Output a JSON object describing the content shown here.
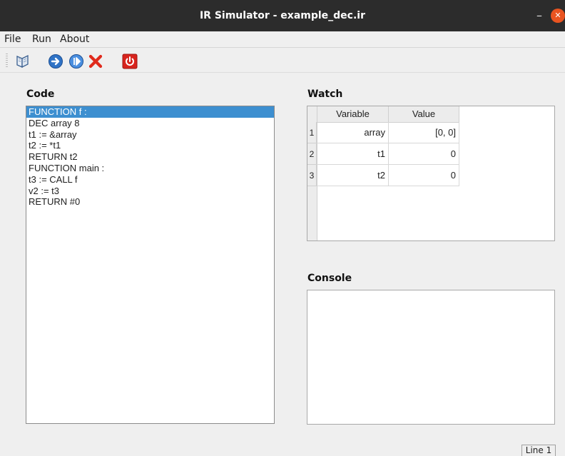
{
  "window": {
    "title": "IR Simulator - example_dec.ir",
    "close_glyph": "✕",
    "minimize_glyph": "–"
  },
  "menu": {
    "items": [
      "File",
      "Run",
      "About"
    ]
  },
  "toolbar": {
    "buttons": [
      {
        "name": "open-file-button",
        "icon": "open-book-icon"
      },
      {
        "name": "run-button",
        "icon": "run-arrow-icon"
      },
      {
        "name": "step-button",
        "icon": "step-icon"
      },
      {
        "name": "stop-button",
        "icon": "red-x-icon"
      },
      {
        "name": "power-button",
        "icon": "power-icon"
      }
    ]
  },
  "code": {
    "heading": "Code",
    "selected_index": 0,
    "lines": [
      "FUNCTION f :",
      "DEC array 8",
      "t1 := &array",
      "t2 := *t1",
      "RETURN t2",
      "FUNCTION main :",
      "t3 := CALL f",
      "v2 := t3",
      "RETURN #0"
    ]
  },
  "watch": {
    "heading": "Watch",
    "columns": [
      "Variable",
      "Value"
    ],
    "rows": [
      {
        "num": "1",
        "variable": "array",
        "value": "[0, 0]"
      },
      {
        "num": "2",
        "variable": "t1",
        "value": "0"
      },
      {
        "num": "3",
        "variable": "t2",
        "value": "0"
      }
    ]
  },
  "console": {
    "heading": "Console",
    "content": ""
  },
  "status": {
    "line": "Line 1"
  },
  "colors": {
    "selection": "#3d8fd0",
    "titlebar": "#2c2c2c",
    "close": "#e95420"
  }
}
